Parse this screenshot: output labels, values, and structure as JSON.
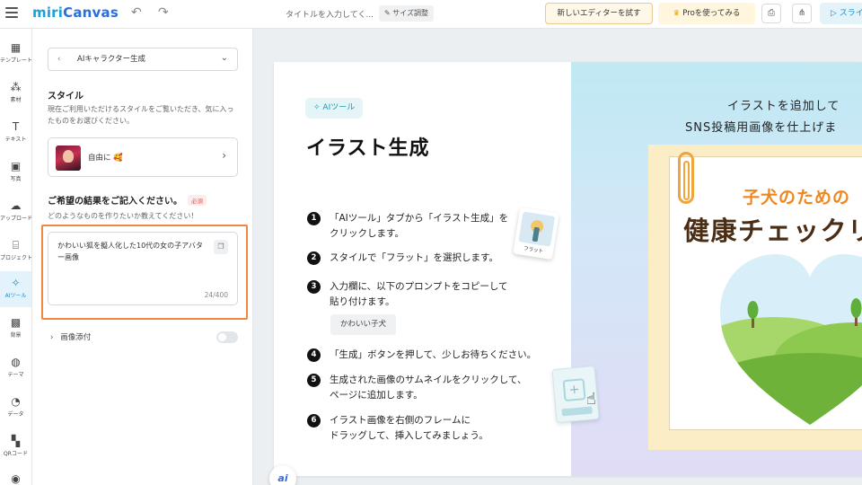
{
  "header": {
    "logo_prefix": "miri",
    "logo_suffix": "Canvas",
    "doc_title": "タイトルを入力してく...",
    "resize_label": "サイズ調整",
    "new_editor_label": "新しいエディターを試す",
    "pro_label": "Proを使ってみる",
    "slide_label": "スライ"
  },
  "nav": {
    "items": [
      {
        "label": "テンプレート",
        "icon": "template-icon"
      },
      {
        "label": "素材",
        "icon": "elements-icon"
      },
      {
        "label": "テキスト",
        "icon": "text-icon"
      },
      {
        "label": "写真",
        "icon": "photo-icon"
      },
      {
        "label": "アップロード",
        "icon": "upload-icon"
      },
      {
        "label": "プロジェクト",
        "icon": "project-icon"
      },
      {
        "label": "AIツール",
        "icon": "ai-tool-icon"
      },
      {
        "label": "背景",
        "icon": "background-icon"
      },
      {
        "label": "テーマ",
        "icon": "theme-icon"
      },
      {
        "label": "データ",
        "icon": "data-icon"
      },
      {
        "label": "QRコード",
        "icon": "qr-code-icon"
      }
    ]
  },
  "panel": {
    "tool_select": "AIキャラクター生成",
    "style_title": "スタイル",
    "style_desc": "現在ご利用いただけるスタイルをご覧いただき、気に入ったものをお選びください。",
    "style_name": "自由に 🥰",
    "result_title": "ご希望の結果をご記入ください。",
    "required_badge": "必須",
    "result_desc": "どのようなものを作りたいか教えてください！",
    "prompt_value": "かわいい狐を擬人化した10代の女の子アバター画像",
    "char_count": "24/400",
    "image_attach": "画像添付"
  },
  "slide_left": {
    "tag": "AIツール",
    "title": "イラスト生成",
    "steps": [
      {
        "num": "1",
        "line1": "「AIツール」タブから「イラスト生成」を",
        "line2": "クリックします。"
      },
      {
        "num": "2",
        "line1": "スタイルで「フラット」を選択します。",
        "line2": ""
      },
      {
        "num": "3",
        "line1": "入力欄に、以下のプロンプトをコピーして",
        "line2": "貼り付けます。"
      },
      {
        "num": "4",
        "line1": "「生成」ボタンを押して、少しお待ちください。",
        "line2": ""
      },
      {
        "num": "5",
        "line1": "生成された画像のサムネイルをクリックして、",
        "line2": "ページに追加します。"
      },
      {
        "num": "6",
        "line1": "イラスト画像を右側のフレームに",
        "line2": "ドラッグして、挿入してみましょう。"
      }
    ],
    "prompt_chip": "かわいい子犬",
    "flat_caption": "フラット"
  },
  "slide_right": {
    "heading_line1": "イラストを追加して",
    "heading_line2": "SNS投稿用画像を仕上げま",
    "sub_title": "子犬のための",
    "big_title": "健康チェックリ"
  },
  "ai_button": "ai",
  "colors": {
    "accent": "#1f88c9",
    "highlight": "#f0883e",
    "sub_title": "#f0861e",
    "big_title": "#4a2d15"
  }
}
